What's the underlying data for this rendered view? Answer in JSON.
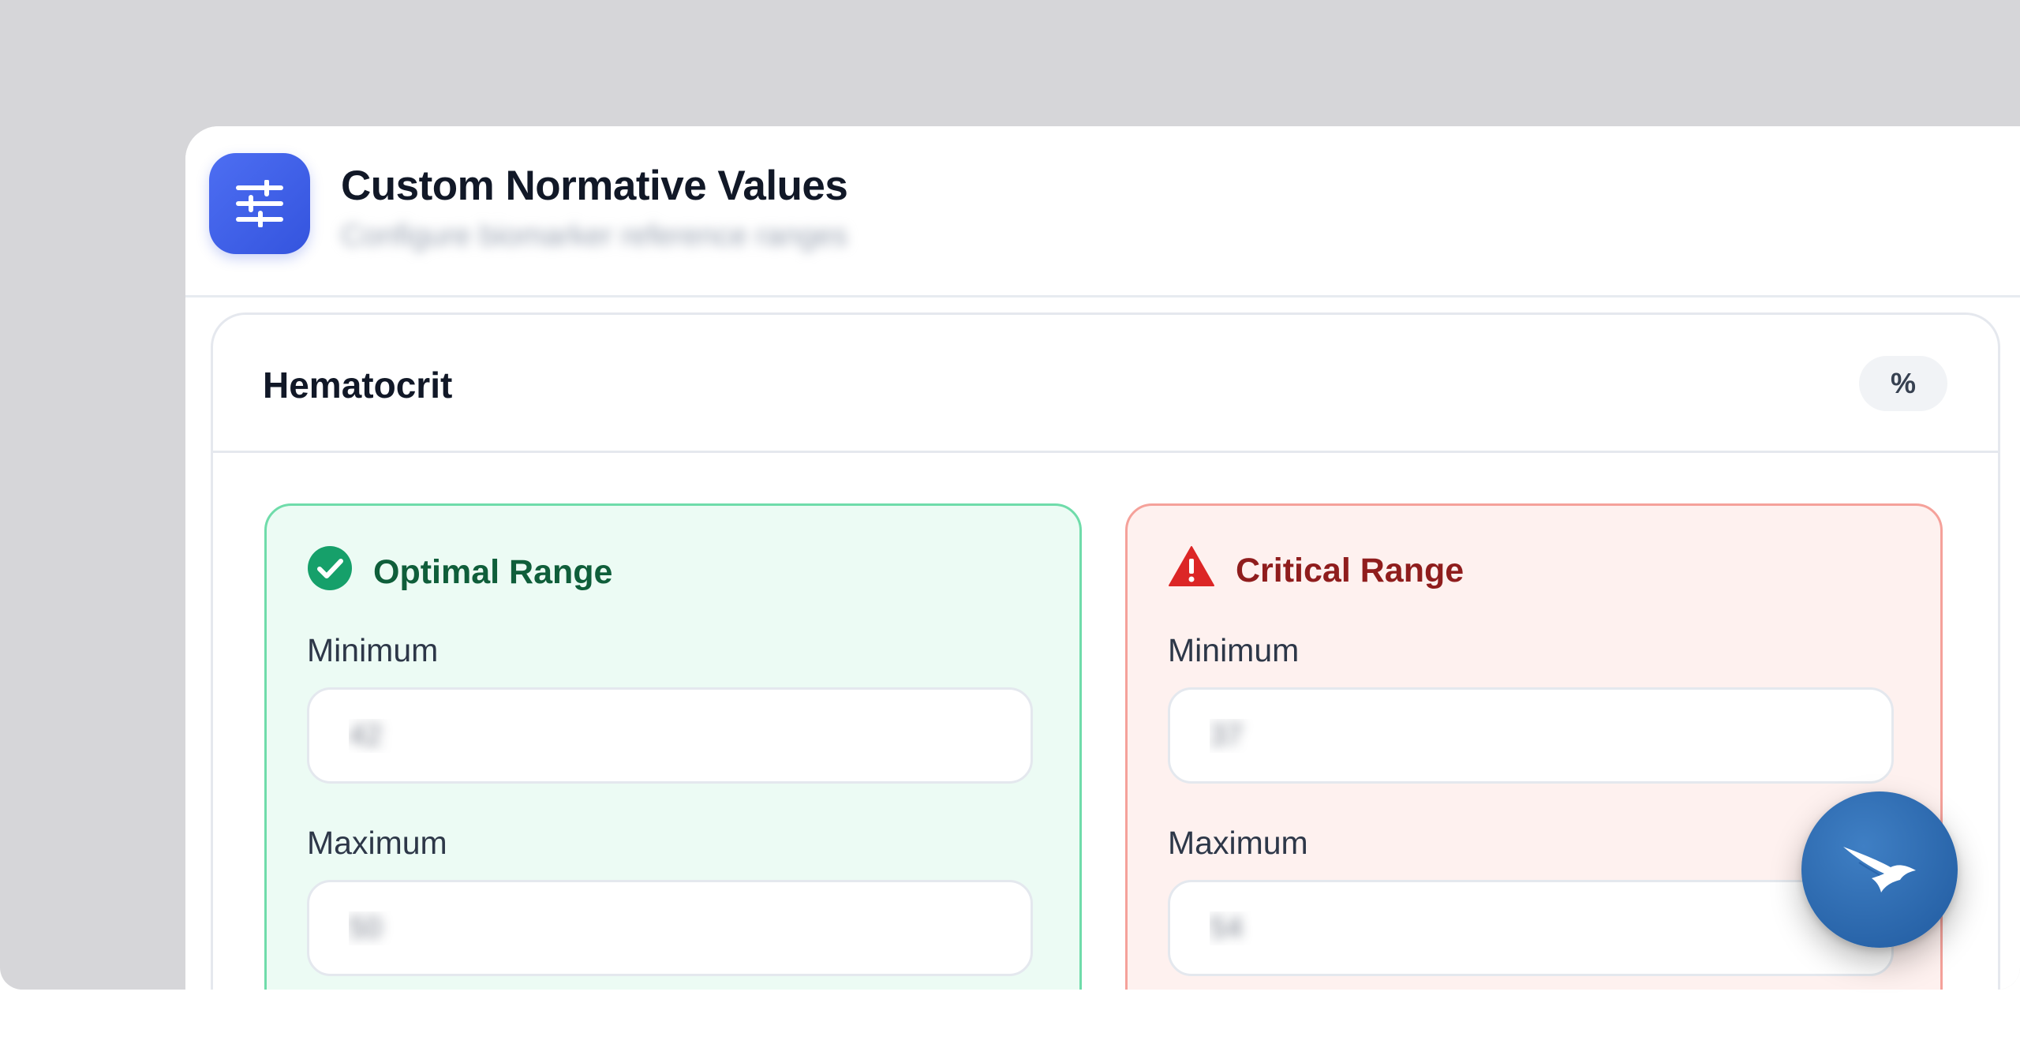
{
  "header": {
    "title": "Custom Normative Values",
    "subtitle": "Configure biomarker reference ranges"
  },
  "biomarker": {
    "name": "Hematocrit",
    "unit": "%"
  },
  "optimal_range": {
    "title": "Optimal Range",
    "min_label": "Minimum",
    "min_value": "42",
    "max_label": "Maximum",
    "max_value": "50",
    "accent_color": "#16a06a"
  },
  "critical_range": {
    "title": "Critical Range",
    "min_label": "Minimum",
    "min_value": "37",
    "max_label": "Maximum",
    "max_value": "54",
    "accent_color": "#dc2626"
  },
  "icons": {
    "app": "sliders-icon",
    "optimal": "check-circle-icon",
    "critical": "warning-triangle-icon",
    "fab": "bird-logo-icon"
  },
  "colors": {
    "brand": "#3f5fe8",
    "fab": "#2a66ad"
  }
}
